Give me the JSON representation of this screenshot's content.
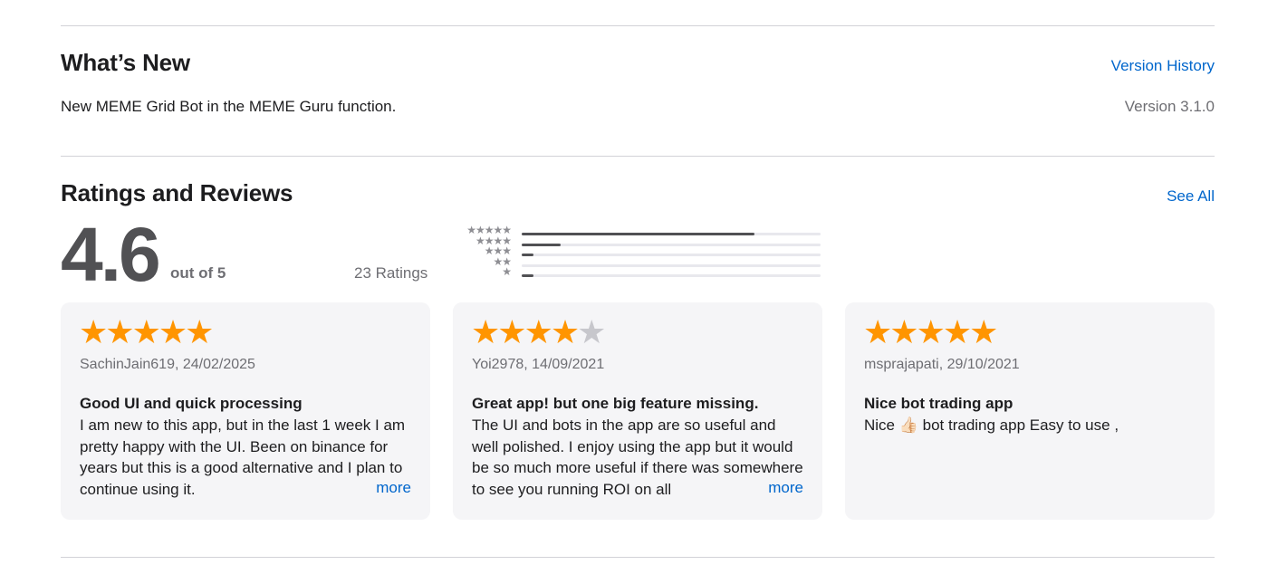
{
  "whats_new": {
    "title": "What’s New",
    "version_history_label": "Version History",
    "notes": "New MEME Grid Bot in the MEME Guru function.",
    "version": "Version 3.1.0"
  },
  "ratings": {
    "title": "Ratings and Reviews",
    "see_all_label": "See All",
    "average": "4.6",
    "out_of": "out of 5",
    "count_label": "23 Ratings",
    "histogram": [
      {
        "stars": "★★★★★",
        "fraction": 0.78
      },
      {
        "stars": "★★★★",
        "fraction": 0.13
      },
      {
        "stars": "★★★",
        "fraction": 0.04
      },
      {
        "stars": "★★",
        "fraction": 0.0
      },
      {
        "stars": "★",
        "fraction": 0.04
      }
    ]
  },
  "reviews": [
    {
      "rating": 5,
      "meta": "SachinJain619, 24/02/2025",
      "title": "Good UI and quick processing",
      "body": "I am new to this app, but in the last 1 week I am pretty happy with the UI. Been on binance for years but this is a good alternative and I plan to continue using it.",
      "more_label": "more"
    },
    {
      "rating": 4,
      "meta": "Yoi2978, 14/09/2021",
      "title": "Great app! but one big feature missing.",
      "body": "The UI and bots in the app are so useful and well polished. I enjoy using the app but it would be so much more useful if there was somewhere to see you running ROI on all",
      "more_label": "more"
    },
    {
      "rating": 5,
      "meta": "msprajapati, 29/10/2021",
      "title": "Nice bot trading app",
      "body": "Nice 👍🏻 bot trading app Easy to use ,",
      "more_label": ""
    }
  ],
  "colors": {
    "accent_link": "#0066cc",
    "star_on": "#ff9500",
    "star_off": "#c7c7cc",
    "card_bg": "#f5f5f7",
    "divider": "#d2d2d7"
  }
}
